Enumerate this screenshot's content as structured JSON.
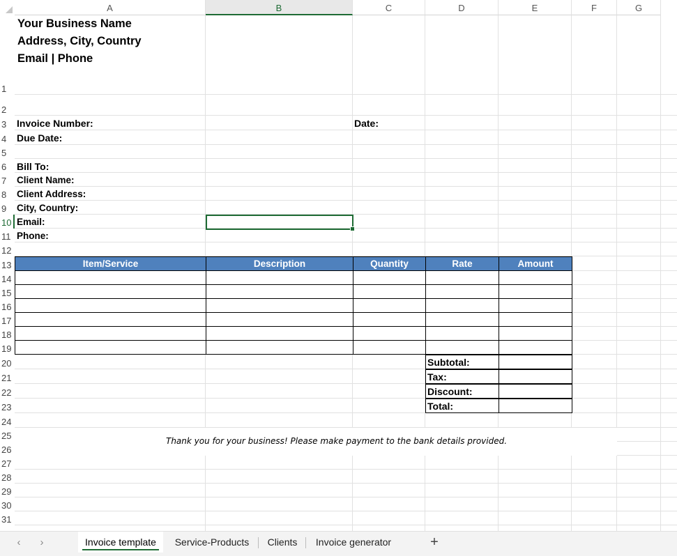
{
  "columns": [
    "A",
    "B",
    "C",
    "D",
    "E",
    "F",
    "G"
  ],
  "rows": [
    "1",
    "2",
    "3",
    "4",
    "5",
    "6",
    "7",
    "8",
    "9",
    "10",
    "11",
    "12",
    "13",
    "14",
    "15",
    "16",
    "17",
    "18",
    "19",
    "20",
    "21",
    "22",
    "23",
    "24",
    "25",
    "26",
    "27",
    "28",
    "29",
    "30",
    "31"
  ],
  "header": {
    "business_name": "Your Business Name",
    "address": "Address, City, Country",
    "contact": "Email | Phone"
  },
  "fields": {
    "invoice_number": "Invoice Number:",
    "date": "Date:",
    "due_date": "Due Date:",
    "bill_to": "Bill To:",
    "client_name": "Client Name:",
    "client_address": "Client Address:",
    "city_country": "City, Country:",
    "email": "Email:",
    "phone": "Phone:"
  },
  "table": {
    "headers": [
      "Item/Service",
      "Description",
      "Quantity",
      "Rate",
      "Amount"
    ],
    "header_color": "#4f81bd"
  },
  "summary": {
    "subtotal": "Subtotal:",
    "tax": "Tax:",
    "discount": "Discount:",
    "total": "Total:"
  },
  "footer_note": "Thank you for your business! Please make payment to the bank details provided.",
  "selected_cell": "B10",
  "sheet_tabs": {
    "prev_icon": "chevron-left",
    "next_icon": "chevron-right",
    "tabs": [
      "Invoice template",
      "Service-Products",
      "Clients",
      "Invoice generator"
    ],
    "active": "Invoice template",
    "add_label": "+"
  },
  "accent_color": "#1e6b34"
}
